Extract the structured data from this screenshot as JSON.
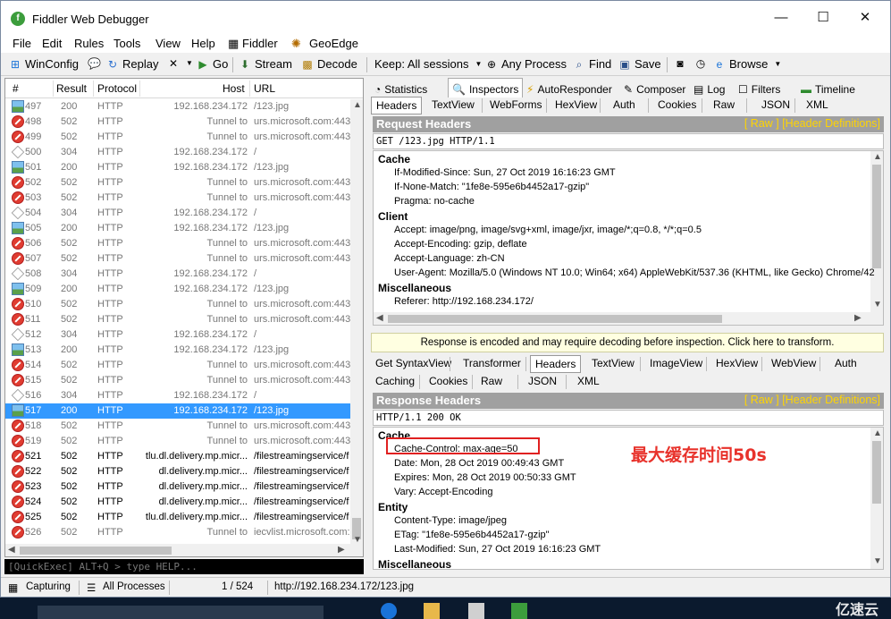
{
  "window": {
    "title": "Fiddler Web Debugger",
    "app_icon": "fiddler-logo-icon",
    "minimize": "—",
    "maximize": "☐",
    "close": "✕"
  },
  "menu": [
    "File",
    "Edit",
    "Rules",
    "Tools",
    "View",
    "Help",
    "Fiddler",
    "GeoEdge"
  ],
  "toolbar": {
    "winconfig": "WinConfig",
    "replay": "Replay",
    "go": "Go",
    "stream": "Stream",
    "decode": "Decode",
    "keep": "Keep: All sessions",
    "process": "Any Process",
    "find": "Find",
    "save": "Save",
    "browse": "Browse"
  },
  "sessions": {
    "columns": [
      "#",
      "Result",
      "Protocol",
      "Host",
      "URL"
    ],
    "rows": [
      {
        "num": "497",
        "result": "200",
        "protocol": "HTTP",
        "host": "192.168.234.172",
        "url": "/123.jpg",
        "icon": "image"
      },
      {
        "num": "498",
        "result": "502",
        "protocol": "HTTP",
        "host": "Tunnel to",
        "url": "urs.microsoft.com:443",
        "icon": "error"
      },
      {
        "num": "499",
        "result": "502",
        "protocol": "HTTP",
        "host": "Tunnel to",
        "url": "urs.microsoft.com:443",
        "icon": "error"
      },
      {
        "num": "500",
        "result": "304",
        "protocol": "HTTP",
        "host": "192.168.234.172",
        "url": "/",
        "icon": "notmodified"
      },
      {
        "num": "501",
        "result": "200",
        "protocol": "HTTP",
        "host": "192.168.234.172",
        "url": "/123.jpg",
        "icon": "image"
      },
      {
        "num": "502",
        "result": "502",
        "protocol": "HTTP",
        "host": "Tunnel to",
        "url": "urs.microsoft.com:443",
        "icon": "error"
      },
      {
        "num": "503",
        "result": "502",
        "protocol": "HTTP",
        "host": "Tunnel to",
        "url": "urs.microsoft.com:443",
        "icon": "error"
      },
      {
        "num": "504",
        "result": "304",
        "protocol": "HTTP",
        "host": "192.168.234.172",
        "url": "/",
        "icon": "notmodified"
      },
      {
        "num": "505",
        "result": "200",
        "protocol": "HTTP",
        "host": "192.168.234.172",
        "url": "/123.jpg",
        "icon": "image"
      },
      {
        "num": "506",
        "result": "502",
        "protocol": "HTTP",
        "host": "Tunnel to",
        "url": "urs.microsoft.com:443",
        "icon": "error"
      },
      {
        "num": "507",
        "result": "502",
        "protocol": "HTTP",
        "host": "Tunnel to",
        "url": "urs.microsoft.com:443",
        "icon": "error"
      },
      {
        "num": "508",
        "result": "304",
        "protocol": "HTTP",
        "host": "192.168.234.172",
        "url": "/",
        "icon": "notmodified"
      },
      {
        "num": "509",
        "result": "200",
        "protocol": "HTTP",
        "host": "192.168.234.172",
        "url": "/123.jpg",
        "icon": "image"
      },
      {
        "num": "510",
        "result": "502",
        "protocol": "HTTP",
        "host": "Tunnel to",
        "url": "urs.microsoft.com:443",
        "icon": "error"
      },
      {
        "num": "511",
        "result": "502",
        "protocol": "HTTP",
        "host": "Tunnel to",
        "url": "urs.microsoft.com:443",
        "icon": "error"
      },
      {
        "num": "512",
        "result": "304",
        "protocol": "HTTP",
        "host": "192.168.234.172",
        "url": "/",
        "icon": "notmodified"
      },
      {
        "num": "513",
        "result": "200",
        "protocol": "HTTP",
        "host": "192.168.234.172",
        "url": "/123.jpg",
        "icon": "image"
      },
      {
        "num": "514",
        "result": "502",
        "protocol": "HTTP",
        "host": "Tunnel to",
        "url": "urs.microsoft.com:443",
        "icon": "error"
      },
      {
        "num": "515",
        "result": "502",
        "protocol": "HTTP",
        "host": "Tunnel to",
        "url": "urs.microsoft.com:443",
        "icon": "error"
      },
      {
        "num": "516",
        "result": "304",
        "protocol": "HTTP",
        "host": "192.168.234.172",
        "url": "/",
        "icon": "notmodified"
      },
      {
        "num": "517",
        "result": "200",
        "protocol": "HTTP",
        "host": "192.168.234.172",
        "url": "/123.jpg",
        "icon": "image",
        "selected": true
      },
      {
        "num": "518",
        "result": "502",
        "protocol": "HTTP",
        "host": "Tunnel to",
        "url": "urs.microsoft.com:443",
        "icon": "error"
      },
      {
        "num": "519",
        "result": "502",
        "protocol": "HTTP",
        "host": "Tunnel to",
        "url": "urs.microsoft.com:443",
        "icon": "error"
      },
      {
        "num": "521",
        "result": "502",
        "protocol": "HTTP",
        "host": "tlu.dl.delivery.mp.micr...",
        "url": "/filestreamingservice/f",
        "icon": "error",
        "dark": true
      },
      {
        "num": "522",
        "result": "502",
        "protocol": "HTTP",
        "host": "dl.delivery.mp.micr...",
        "url": "/filestreamingservice/f",
        "icon": "error",
        "dark": true
      },
      {
        "num": "523",
        "result": "502",
        "protocol": "HTTP",
        "host": "dl.delivery.mp.micr...",
        "url": "/filestreamingservice/f",
        "icon": "error",
        "dark": true
      },
      {
        "num": "524",
        "result": "502",
        "protocol": "HTTP",
        "host": "dl.delivery.mp.micr...",
        "url": "/filestreamingservice/f",
        "icon": "error",
        "dark": true
      },
      {
        "num": "525",
        "result": "502",
        "protocol": "HTTP",
        "host": "tlu.dl.delivery.mp.micr...",
        "url": "/filestreamingservice/f",
        "icon": "error",
        "dark": true
      },
      {
        "num": "526",
        "result": "502",
        "protocol": "HTTP",
        "host": "Tunnel to",
        "url": "iecvlist.microsoft.com:",
        "icon": "error"
      }
    ]
  },
  "quickexec": "[QuickExec] ALT+Q > type HELP...",
  "inspector_tabs": [
    "Statistics",
    "Inspectors",
    "AutoResponder",
    "Composer",
    "Log",
    "Filters",
    "Timeline"
  ],
  "request": {
    "subtabs": [
      "Headers",
      "TextView",
      "WebForms",
      "HexView",
      "Auth",
      "Cookies",
      "Raw",
      "JSON",
      "XML"
    ],
    "header_title": "Request Headers",
    "links": "[ Raw ]   [Header Definitions]",
    "first_line": "GET /123.jpg HTTP/1.1",
    "groups": [
      {
        "name": "Cache",
        "items": [
          "If-Modified-Since: Sun, 27 Oct 2019 16:16:23 GMT",
          "If-None-Match: \"1fe8e-595e6b4452a17-gzip\"",
          "Pragma: no-cache"
        ]
      },
      {
        "name": "Client",
        "items": [
          "Accept: image/png, image/svg+xml, image/jxr, image/*;q=0.8, */*;q=0.5",
          "Accept-Encoding: gzip, deflate",
          "Accept-Language: zh-CN",
          "User-Agent: Mozilla/5.0 (Windows NT 10.0; Win64; x64) AppleWebKit/537.36 (KHTML, like Gecko) Chrome/42"
        ]
      },
      {
        "name": "Miscellaneous",
        "items": [
          "Referer: http://192.168.234.172/"
        ]
      }
    ]
  },
  "notice": "Response is encoded and may require decoding before inspection. Click here to transform.",
  "response": {
    "subtabs_row1": [
      "Get SyntaxView",
      "Transformer",
      "Headers",
      "TextView",
      "ImageView",
      "HexView",
      "WebView",
      "Auth"
    ],
    "subtabs_row2": [
      "Caching",
      "Cookies",
      "Raw",
      "JSON",
      "XML"
    ],
    "header_title": "Response Headers",
    "links": "[ Raw ]   [Header Definitions]",
    "first_line": "HTTP/1.1 200 OK",
    "groups": [
      {
        "name": "Cache",
        "items": [
          "Cache-Control: max-age=50",
          "Date: Mon, 28 Oct 2019 00:49:43 GMT",
          "Expires: Mon, 28 Oct 2019 00:50:33 GMT",
          "Vary: Accept-Encoding"
        ]
      },
      {
        "name": "Entity",
        "items": [
          "Content-Type: image/jpeg",
          "ETag: \"1fe8e-595e6b4452a17-gzip\"",
          "Last-Modified: Sun, 27 Oct 2019 16:16:23 GMT"
        ]
      },
      {
        "name": "Miscellaneous",
        "items": []
      }
    ]
  },
  "annotation": "最大缓存时间50s",
  "status": {
    "capturing": "Capturing",
    "processes": "All Processes",
    "count": "1 / 524",
    "url": "http://192.168.234.172/123.jpg"
  },
  "taskbar": {
    "watermark": "亿速云"
  },
  "colors": {
    "selection": "#3399ff",
    "header_bar": "#a0a0a0",
    "link_yellow": "#ffd400",
    "annotation_red": "#e8322b"
  }
}
